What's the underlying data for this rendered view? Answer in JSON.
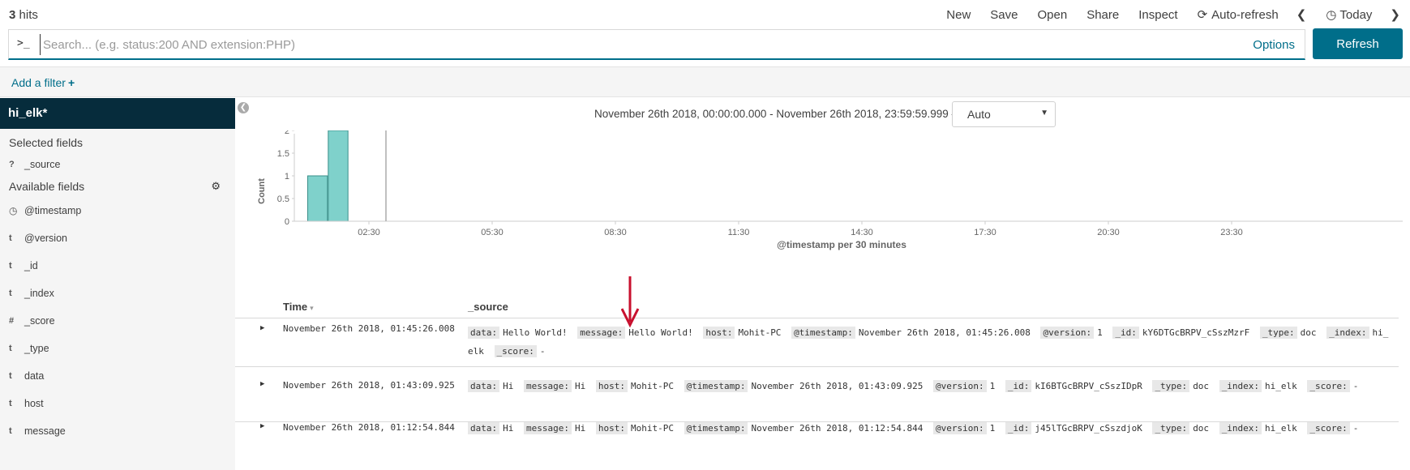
{
  "topbar": {
    "hits_count": "3",
    "hits_label": "hits",
    "menu": {
      "new": "New",
      "save": "Save",
      "open": "Open",
      "share": "Share",
      "inspect": "Inspect",
      "auto_refresh": "Auto-refresh",
      "today": "Today"
    }
  },
  "search": {
    "prompt": ">_",
    "placeholder": "Search... (e.g. status:200 AND extension:PHP)",
    "value": "",
    "options": "Options",
    "refresh": "Refresh"
  },
  "filter": {
    "add_filter": "Add a filter",
    "plus": "+"
  },
  "sidebar": {
    "index": "hi_elk*",
    "selected_title": "Selected fields",
    "selected": [
      {
        "type": "?",
        "name": "_source"
      }
    ],
    "available_title": "Available fields",
    "available": [
      {
        "type": "clock",
        "name": "@timestamp"
      },
      {
        "type": "t",
        "name": "@version"
      },
      {
        "type": "t",
        "name": "_id"
      },
      {
        "type": "t",
        "name": "_index"
      },
      {
        "type": "#",
        "name": "_score"
      },
      {
        "type": "t",
        "name": "_type"
      },
      {
        "type": "t",
        "name": "data"
      },
      {
        "type": "t",
        "name": "host"
      },
      {
        "type": "t",
        "name": "message"
      }
    ]
  },
  "main": {
    "time_range": "November 26th 2018, 00:00:00.000 - November 26th 2018, 23:59:59.999 —",
    "interval": "Auto"
  },
  "chart_data": {
    "type": "bar",
    "xlabel": "@timestamp per 30 minutes",
    "ylabel": "Count",
    "ylim": [
      0,
      2
    ],
    "yticks": [
      "0",
      "0.5",
      "1",
      "1.5",
      "2"
    ],
    "xticks": [
      "02:30",
      "05:30",
      "08:30",
      "11:30",
      "14:30",
      "17:30",
      "20:30",
      "23:30"
    ],
    "categories": [
      "01:00",
      "01:30"
    ],
    "values": [
      1,
      2
    ],
    "grid": false
  },
  "table": {
    "col_time": "Time",
    "col_source": "_source",
    "rows": [
      {
        "time": "November 26th 2018, 01:45:26.008",
        "k_data": "data:",
        "v_data": "Hello World!",
        "k_message": "message:",
        "v_message": "Hello World!",
        "k_host": "host:",
        "v_host": "Mohit-PC",
        "k_ts": "@timestamp:",
        "v_ts": "November 26th 2018, 01:45:26.008",
        "k_ver": "@version:",
        "v_ver": "1",
        "k_id": "_id:",
        "v_id": "kY6DTGcBRPV_cSszMzrF",
        "k_type": "_type:",
        "v_type": "doc",
        "k_index": "_index:",
        "v_index": "hi_elk",
        "k_score": "_score:",
        "v_score": "-"
      },
      {
        "time": "November 26th 2018, 01:43:09.925",
        "k_data": "data:",
        "v_data": "Hi",
        "k_message": "message:",
        "v_message": "Hi",
        "k_host": "host:",
        "v_host": "Mohit-PC",
        "k_ts": "@timestamp:",
        "v_ts": "November 26th 2018, 01:43:09.925",
        "k_ver": "@version:",
        "v_ver": "1",
        "k_id": "_id:",
        "v_id": "kI6BTGcBRPV_cSszIDpR",
        "k_type": "_type:",
        "v_type": "doc",
        "k_index": "_index:",
        "v_index": "hi_elk",
        "k_score": "_score:",
        "v_score": "-"
      },
      {
        "time": "November 26th 2018, 01:12:54.844",
        "k_data": "data:",
        "v_data": "Hi",
        "k_message": "message:",
        "v_message": "Hi",
        "k_host": "host:",
        "v_host": "Mohit-PC",
        "k_ts": "@timestamp:",
        "v_ts": "November 26th 2018, 01:12:54.844",
        "k_ver": "@version:",
        "v_ver": "1",
        "k_id": "_id:",
        "v_id": "j45lTGcBRPV_cSszdjoK",
        "k_type": "_type:",
        "v_type": "doc",
        "k_index": "_index:",
        "v_index": "hi_elk",
        "k_score": "_score:",
        "v_score": "-"
      }
    ]
  },
  "colors": {
    "accent": "#006e8a",
    "bar_fill": "#7fd1cb",
    "bar_stroke": "#3a8f8a",
    "arrow": "#c8102e",
    "index_bg": "#062c3c"
  }
}
